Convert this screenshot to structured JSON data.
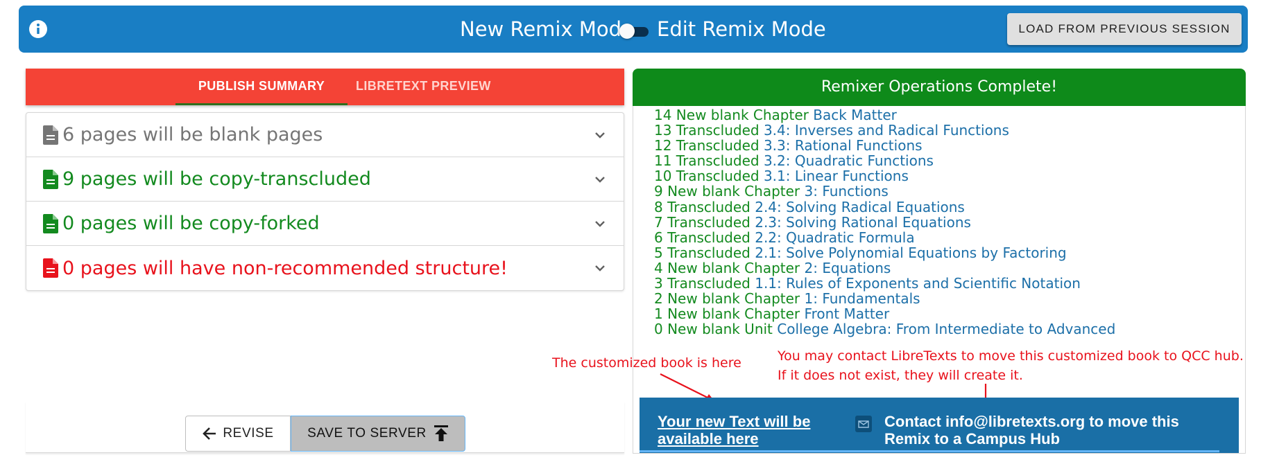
{
  "header": {
    "new_mode_label": "New Remix Mode",
    "edit_mode_label": "Edit Remix Mode",
    "load_button": "LOAD FROM PREVIOUS SESSION",
    "bar_color": "#197ec4"
  },
  "left_panel": {
    "tabs": [
      {
        "label": "PUBLISH SUMMARY",
        "active": true
      },
      {
        "label": "LIBRETEXT PREVIEW",
        "active": false
      }
    ],
    "summary_rows": [
      {
        "text": "6 pages will be blank pages",
        "color": "#757575"
      },
      {
        "text": "9 pages will be copy-transcluded",
        "color": "#138a1f"
      },
      {
        "text": "0 pages will be copy-forked",
        "color": "#138a1f"
      },
      {
        "text": "0 pages will have non-recommended structure!",
        "color": "#e8121c"
      }
    ],
    "revise_button": "REVISE",
    "save_button": "SAVE TO SERVER"
  },
  "right_panel": {
    "header": "Remixer Operations Complete!",
    "operations": [
      {
        "action": "14 New blank Chapter",
        "target": "Back Matter"
      },
      {
        "action": "13 Transcluded",
        "target": "3.4: Inverses and Radical Functions"
      },
      {
        "action": "12 Transcluded",
        "target": "3.3: Rational Functions"
      },
      {
        "action": "11 Transcluded",
        "target": "3.2: Quadratic Functions"
      },
      {
        "action": "10 Transcluded",
        "target": "3.1: Linear Functions"
      },
      {
        "action": "9 New blank Chapter",
        "target": "3: Functions"
      },
      {
        "action": "8 Transcluded",
        "target": "2.4: Solving Radical Equations"
      },
      {
        "action": "7 Transcluded",
        "target": "2.3: Solving Rational Equations"
      },
      {
        "action": "6 Transcluded",
        "target": "2.2: Quadratic Formula"
      },
      {
        "action": "5 Transcluded",
        "target": "2.1: Solve Polynomial Equations by Factoring"
      },
      {
        "action": "4 New blank Chapter",
        "target": "2: Equations"
      },
      {
        "action": "3 Transcluded",
        "target": "1.1: Rules of Exponents and Scientific Notation"
      },
      {
        "action": "2 New blank Chapter",
        "target": "1: Fundamentals"
      },
      {
        "action": "1 New blank Chapter",
        "target": "Front Matter"
      },
      {
        "action": "0 New blank Unit",
        "target": "College Algebra: From Intermediate to Advanced"
      }
    ],
    "annotation_book": "The customized book is here",
    "annotation_contact_line1": "You may contact LibreTexts to move this customized book to QCC hub.",
    "annotation_contact_line2": "If it does not exist, they will create it.",
    "new_text_link": "Your new Text will be available here",
    "contact_text": "Contact info@libretexts.org to move this Remix to a Campus Hub"
  },
  "colors": {
    "tabs_bg": "#f44336",
    "complete_bg": "#0e8a1a",
    "bottom_bar_bg": "#1a6fa6",
    "annotation": "#e8121c"
  }
}
